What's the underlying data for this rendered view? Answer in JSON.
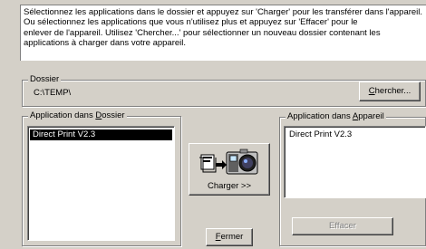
{
  "instructions": "Sélectionnez les applications dans le dossier et appuyez sur 'Charger' pour les transférer dans l'appareil. Ou sélectionnez les applications que vous n'utilisez plus et appuyez sur 'Effacer' pour le\nenlever de l'appareil. Utilisez 'Chercher...' pour sélectionner un nouveau dossier contenant les\napplications à charger dans votre appareil.",
  "dossier": {
    "title": "Dossier",
    "path": "C:\\TEMP\\",
    "browse_button": {
      "accel": "C",
      "rest": "hercher..."
    }
  },
  "folder_apps": {
    "title": {
      "prefix": "Application dans ",
      "accel": "D",
      "rest": "ossier"
    },
    "items": [
      "Direct Print V2.3"
    ]
  },
  "device_apps": {
    "title": {
      "prefix": "Application dans ",
      "accel": "A",
      "rest": "ppareil"
    },
    "items": [
      "Direct Print V2.3"
    ]
  },
  "charger_button": {
    "label": "Charger >>",
    "icon": "camera-transfer-icon"
  },
  "effacer_button": {
    "label": "Effacer",
    "enabled": false
  },
  "fermer_button": {
    "accel": "F",
    "rest": "ermer"
  }
}
